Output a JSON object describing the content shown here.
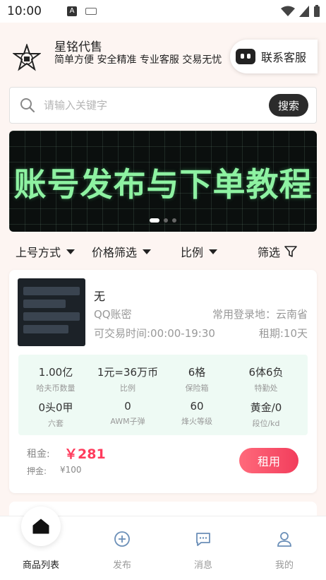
{
  "status_bar": {
    "time": "10:00",
    "a_badge": "A"
  },
  "header": {
    "brand_name": "星铭代售",
    "slogan": "简单方便 安全精准 专业客服 交易无忧",
    "contact_label": "联系客服"
  },
  "search": {
    "placeholder": "请输入关键字",
    "button_label": "搜索"
  },
  "banner": {
    "text": "账号发布与下单教程",
    "slide_count": 3,
    "active_slide": 1
  },
  "filters": [
    {
      "label": "上号方式",
      "has_caret": true
    },
    {
      "label": "价格筛选",
      "has_caret": true
    },
    {
      "label": "比例",
      "has_caret": true
    },
    {
      "label": "筛选",
      "has_caret": false
    }
  ],
  "listing": {
    "title": "无",
    "account_type": "QQ账密",
    "login_region": "常用登录地：云南省",
    "trade_time": "可交易时间:00:00-19:30",
    "rent_period": "租期:10天",
    "stats": [
      {
        "value": "1.00亿",
        "label": "哈夫币数量"
      },
      {
        "value": "1元=36万币",
        "label": "比例"
      },
      {
        "value": "6格",
        "label": "保险箱"
      },
      {
        "value": "6体6负",
        "label": "特勤处"
      },
      {
        "value": "0头0甲",
        "label": "六套"
      },
      {
        "value": "0",
        "label": "AWM子弹"
      },
      {
        "value": "60",
        "label": "烽火等级"
      },
      {
        "value": "黄金/0",
        "label": "段位/kd"
      }
    ],
    "rent_label": "租金:",
    "rent_price": "￥281",
    "deposit_label": "押金:",
    "deposit_value": "¥100",
    "rent_button": "租用"
  },
  "tabbar": {
    "items": [
      {
        "label": "商品列表",
        "icon": "home-icon",
        "active": true
      },
      {
        "label": "发布",
        "icon": "publish-icon",
        "active": false
      },
      {
        "label": "消息",
        "icon": "message-icon",
        "active": false
      },
      {
        "label": "我的",
        "icon": "profile-icon",
        "active": false
      }
    ]
  },
  "colors": {
    "accent": "#f23d5c",
    "banner_text": "#8ef2a2",
    "stats_bg": "#eefaf4"
  }
}
